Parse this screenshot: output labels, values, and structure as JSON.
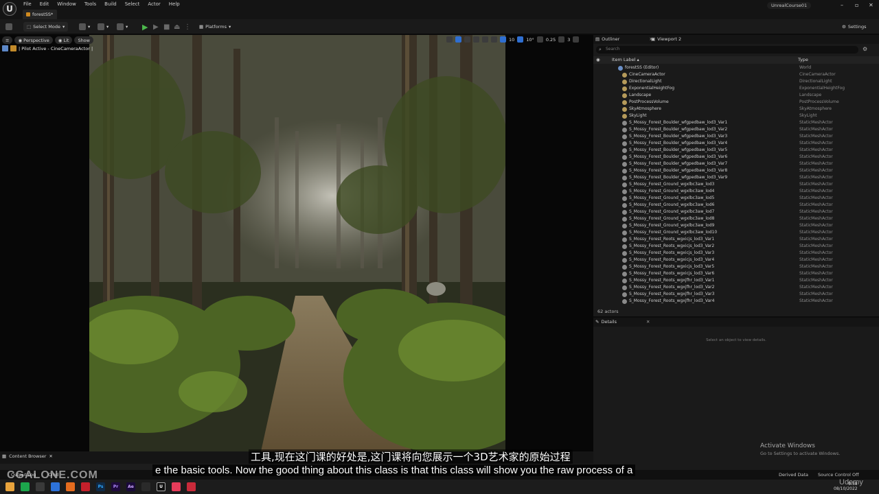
{
  "titlebar": {
    "menu": [
      "File",
      "Edit",
      "Window",
      "Tools",
      "Build",
      "Select",
      "Actor",
      "Help"
    ],
    "document_tab": "forestSS*",
    "project_name": "UnrealCourse01"
  },
  "toolbar": {
    "select_mode": "Select Mode",
    "platforms": "Platforms",
    "settings": "Settings"
  },
  "viewport": {
    "perspective": "Perspective",
    "lit": "Lit",
    "show": "Show",
    "pilot": "| Pilot Active - CineCameraActor |",
    "grid_snap": "10",
    "rot_snap": "10°",
    "scale_snap": "0.25",
    "camera_speed": "3"
  },
  "outliner": {
    "tab_label": "Outliner",
    "tab2_label": "Viewport 2",
    "search_placeholder": "Search",
    "col_item": "Item Label ▴",
    "col_type": "Type",
    "count": "62 actors",
    "root": {
      "label": "forestSS (Editor)",
      "type": "World"
    },
    "rows": [
      {
        "label": "CineCameraActor",
        "type": "CineCameraActor"
      },
      {
        "label": "DirectionalLight",
        "type": "DirectionalLight"
      },
      {
        "label": "ExponentialHeightFog",
        "type": "ExponentialHeightFog"
      },
      {
        "label": "Landscape",
        "type": "Landscape"
      },
      {
        "label": "PostProcessVolume",
        "type": "PostProcessVolume"
      },
      {
        "label": "SkyAtmosphere",
        "type": "SkyAtmosphere"
      },
      {
        "label": "SkyLight",
        "type": "SkyLight"
      },
      {
        "label": "S_Mossy_Forest_Boulder_wfgpedbaw_lod3_Var1",
        "type": "StaticMeshActor"
      },
      {
        "label": "S_Mossy_Forest_Boulder_wfgpedbaw_lod3_Var2",
        "type": "StaticMeshActor"
      },
      {
        "label": "S_Mossy_Forest_Boulder_wfgpedbaw_lod3_Var3",
        "type": "StaticMeshActor"
      },
      {
        "label": "S_Mossy_Forest_Boulder_wfgpedbaw_lod3_Var4",
        "type": "StaticMeshActor"
      },
      {
        "label": "S_Mossy_Forest_Boulder_wfgpedbaw_lod3_Var5",
        "type": "StaticMeshActor"
      },
      {
        "label": "S_Mossy_Forest_Boulder_wfgpedbaw_lod3_Var6",
        "type": "StaticMeshActor"
      },
      {
        "label": "S_Mossy_Forest_Boulder_wfgpedbaw_lod3_Var7",
        "type": "StaticMeshActor"
      },
      {
        "label": "S_Mossy_Forest_Boulder_wfgpedbaw_lod3_Var8",
        "type": "StaticMeshActor"
      },
      {
        "label": "S_Mossy_Forest_Boulder_wfgpedbaw_lod3_Var9",
        "type": "StaticMeshActor"
      },
      {
        "label": "S_Mossy_Forest_Ground_wgxlbc3aw_lod3",
        "type": "StaticMeshActor"
      },
      {
        "label": "S_Mossy_Forest_Ground_wgxlbc3aw_lod4",
        "type": "StaticMeshActor"
      },
      {
        "label": "S_Mossy_Forest_Ground_wgxlbc3aw_lod5",
        "type": "StaticMeshActor"
      },
      {
        "label": "S_Mossy_Forest_Ground_wgxlbc3aw_lod6",
        "type": "StaticMeshActor"
      },
      {
        "label": "S_Mossy_Forest_Ground_wgxlbc3aw_lod7",
        "type": "StaticMeshActor"
      },
      {
        "label": "S_Mossy_Forest_Ground_wgxlbc3aw_lod8",
        "type": "StaticMeshActor"
      },
      {
        "label": "S_Mossy_Forest_Ground_wgxlbc3aw_lod9",
        "type": "StaticMeshActor"
      },
      {
        "label": "S_Mossy_Forest_Ground_wgxlbc3aw_lod10",
        "type": "StaticMeshActor"
      },
      {
        "label": "S_Mossy_Forest_Roots_wgxicjs_lod3_Var1",
        "type": "StaticMeshActor"
      },
      {
        "label": "S_Mossy_Forest_Roots_wgxicjs_lod3_Var2",
        "type": "StaticMeshActor"
      },
      {
        "label": "S_Mossy_Forest_Roots_wgxicjs_lod3_Var3",
        "type": "StaticMeshActor"
      },
      {
        "label": "S_Mossy_Forest_Roots_wgxicjs_lod3_Var4",
        "type": "StaticMeshActor"
      },
      {
        "label": "S_Mossy_Forest_Roots_wgxicjs_lod3_Var5",
        "type": "StaticMeshActor"
      },
      {
        "label": "S_Mossy_Forest_Roots_wgxicjs_lod3_Var6",
        "type": "StaticMeshActor"
      },
      {
        "label": "S_Mossy_Forest_Roots_wgxjfhr_lod3_Var1",
        "type": "StaticMeshActor"
      },
      {
        "label": "S_Mossy_Forest_Roots_wgxjfhr_lod3_Var2",
        "type": "StaticMeshActor"
      },
      {
        "label": "S_Mossy_Forest_Roots_wgxjfhr_lod3_Var3",
        "type": "StaticMeshActor"
      },
      {
        "label": "S_Mossy_Forest_Roots_wgxjfhr_lod3_Var4",
        "type": "StaticMeshActor"
      }
    ]
  },
  "details": {
    "tab_label": "Details",
    "hint": "Select an object to view details."
  },
  "bottom": {
    "content_browser": "Content Browser",
    "output_log": "Output Log",
    "cmd": "Cmd",
    "derived_data": "Derived Data",
    "source_control": "Source Control Off"
  },
  "windows": {
    "activate_title": "Activate Windows",
    "activate_sub": "Go to Settings to activate Windows.",
    "clock_time": "9:58",
    "clock_date": "08/10/2022"
  },
  "subtitles": {
    "chinese": "工具,现在这门课的好处是,这门课将向您展示一个3D艺术家的原始过程",
    "english": "e the basic tools. Now the good thing about this class is that this class will show you the raw process of a"
  },
  "watermarks": {
    "left": "CGALONE.COM",
    "right": "Udemy"
  },
  "colors": {
    "accent_blue": "#2f6fd1",
    "play_green": "#4cb84c",
    "panel_bg": "#1a1a1a"
  }
}
